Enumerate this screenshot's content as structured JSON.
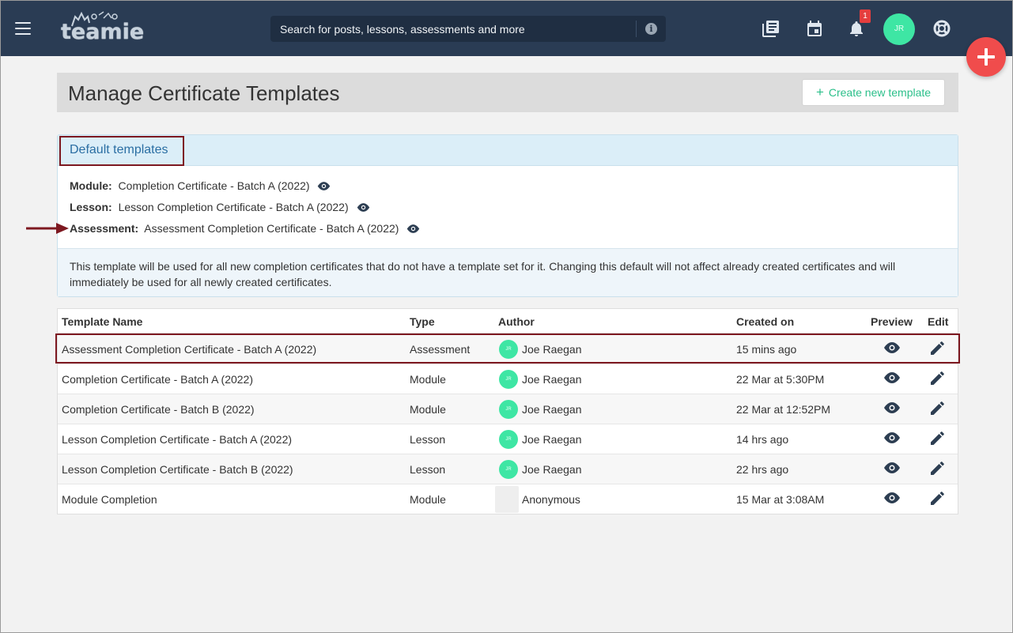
{
  "topbar": {
    "logo_text": "teamie",
    "search_placeholder": "Search for posts, lessons, assessments and more",
    "notification_count": "1",
    "avatar_initials": "JR",
    "icons": [
      "menu-icon",
      "book-icon",
      "calendar-icon",
      "bell-icon",
      "help-lifebuoy-icon",
      "add-icon"
    ]
  },
  "header": {
    "title": "Manage Certificate Templates",
    "create_button": "Create new template",
    "create_icon": "+"
  },
  "defaults": {
    "title": "Default templates",
    "module_label": "Module:",
    "module_value": "Completion Certificate - Batch A (2022)",
    "lesson_label": "Lesson:",
    "lesson_value": "Lesson Completion Certificate - Batch A (2022)",
    "assessment_label": "Assessment:",
    "assessment_value": "Assessment Completion Certificate - Batch A (2022)",
    "note": "This template will be used for all new completion certificates that do not have a template set for it. Changing this default will not affect already created certificates and will immediately be used for all newly created certificates."
  },
  "table": {
    "headers": {
      "name": "Template Name",
      "type": "Type",
      "author": "Author",
      "created": "Created on",
      "preview": "Preview",
      "edit": "Edit"
    },
    "rows": [
      {
        "name": "Assessment Completion Certificate - Batch A (2022)",
        "type": "Assessment",
        "avatar": "JR",
        "author": "Joe Raegan",
        "created": "15 mins ago"
      },
      {
        "name": "Completion Certificate - Batch A (2022)",
        "type": "Module",
        "avatar": "JR",
        "author": "Joe Raegan",
        "created": "22 Mar at 5:30PM"
      },
      {
        "name": "Completion Certificate - Batch B (2022)",
        "type": "Module",
        "avatar": "JR",
        "author": "Joe Raegan",
        "created": "22 Mar at 12:52PM"
      },
      {
        "name": "Lesson Completion Certificate - Batch A (2022)",
        "type": "Lesson",
        "avatar": "JR",
        "author": "Joe Raegan",
        "created": "14 hrs ago"
      },
      {
        "name": "Lesson Completion Certificate - Batch B (2022)",
        "type": "Lesson",
        "avatar": "JR",
        "author": "Joe Raegan",
        "created": "22 hrs ago"
      },
      {
        "name": "Module Completion",
        "type": "Module",
        "avatar": "",
        "author": "Anonymous",
        "created": "15 Mar at 3:08AM"
      }
    ]
  },
  "colors": {
    "topbar": "#2a3c54",
    "accent_green": "#2bbf8a",
    "avatar": "#3ee6a4",
    "fab": "#f04c4c",
    "highlight": "#7d1820",
    "link_blue": "#2a6ea3"
  }
}
